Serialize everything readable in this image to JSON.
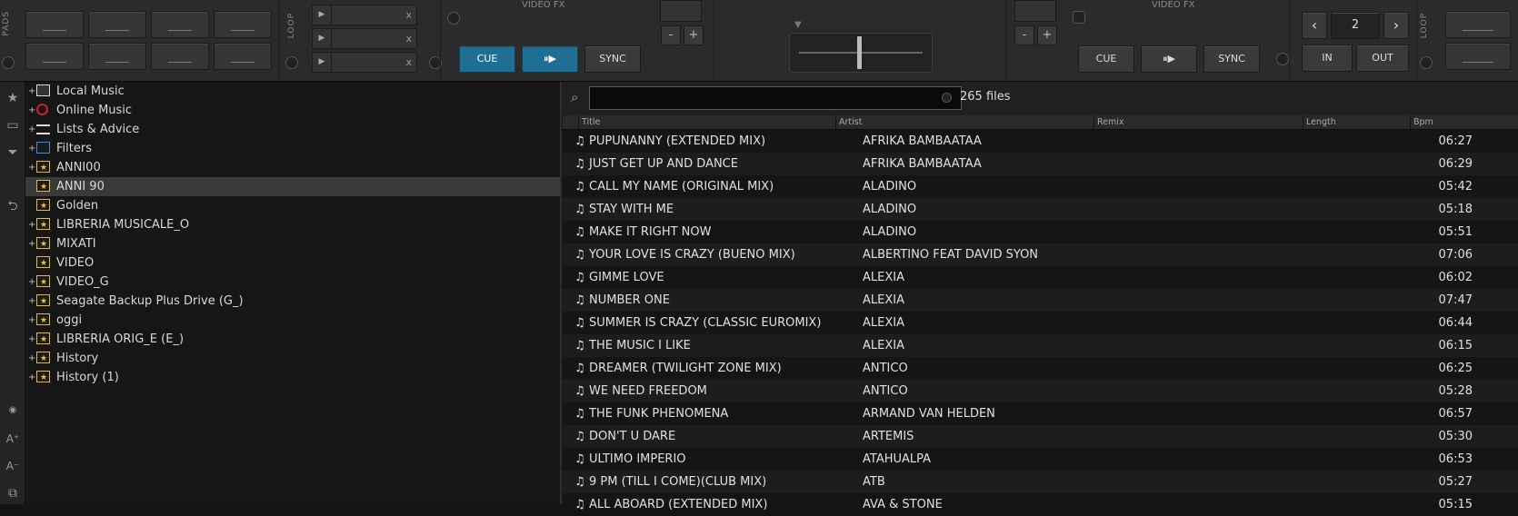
{
  "deck": {
    "pads_label": "PADS",
    "loop_label": "LOOP",
    "loop_close_label": "x",
    "video_fx_label": "VIDEO FX",
    "left_deck": {
      "cue": "CUE",
      "play": "⏸▶",
      "sync": "SYNC"
    },
    "right_deck": {
      "cue": "CUE",
      "play": "⏸▶",
      "sync": "SYNC"
    },
    "fx_minus": "-",
    "fx_plus": "+",
    "loop_size": "2",
    "prev": "‹",
    "next": "›",
    "loop_in": "IN",
    "loop_out": "OUT",
    "colors": {
      "accent": "#1f6f95",
      "panel": "#2b2b2b"
    }
  },
  "sidebar_icons": [
    "favorites-icon",
    "add-folder-icon",
    "filter-icon",
    "back-icon",
    "text-size-up-icon",
    "text-size-down-icon",
    "window-icon"
  ],
  "tree": {
    "items": [
      {
        "label": "Local Music",
        "icon": "computer-icon",
        "expand": "+"
      },
      {
        "label": "Online Music",
        "icon": "globe-icon",
        "expand": "+"
      },
      {
        "label": "Lists & Advice",
        "icon": "list-icon",
        "expand": "+"
      },
      {
        "label": "Filters",
        "icon": "filter-folder-icon",
        "expand": "+"
      },
      {
        "label": "ANNI00",
        "icon": "star-folder-icon",
        "expand": "+"
      },
      {
        "label": "ANNI 90",
        "icon": "star-folder-icon",
        "expand": "",
        "selected": true
      },
      {
        "label": "Golden",
        "icon": "star-folder-icon",
        "expand": ""
      },
      {
        "label": "LIBRERIA MUSICALE_O",
        "icon": "star-folder-icon",
        "expand": "+"
      },
      {
        "label": "MIXATI",
        "icon": "star-folder-icon",
        "expand": "+"
      },
      {
        "label": "VIDEO",
        "icon": "star-folder-icon",
        "expand": ""
      },
      {
        "label": "VIDEO_G",
        "icon": "star-folder-icon",
        "expand": "+"
      },
      {
        "label": "Seagate Backup Plus Drive (G_)",
        "icon": "star-folder-icon",
        "expand": "+"
      },
      {
        "label": "oggi",
        "icon": "star-folder-icon",
        "expand": "+"
      },
      {
        "label": "LIBRERIA ORIG_E (E_)",
        "icon": "star-folder-icon",
        "expand": "+"
      },
      {
        "label": "History",
        "icon": "star-folder-icon",
        "expand": "+"
      },
      {
        "label": "History (1)",
        "icon": "star-folder-icon",
        "expand": "+"
      }
    ],
    "folders_tab": "folders"
  },
  "browser": {
    "search_value": "",
    "file_count": "265 files",
    "columns": [
      "Title",
      "Artist",
      "Remix",
      "Length",
      "Bpm"
    ],
    "rows": [
      {
        "title": "PUPUNANNY (EXTENDED MIX)",
        "artist": "AFRIKA BAMBAATAA",
        "length": "06:27"
      },
      {
        "title": "JUST GET UP AND DANCE",
        "artist": "AFRIKA BAMBAATAA",
        "length": "06:29"
      },
      {
        "title": "CALL MY NAME (ORIGINAL MIX)",
        "artist": "ALADINO",
        "length": "05:42"
      },
      {
        "title": "STAY WITH ME",
        "artist": "ALADINO",
        "length": "05:18"
      },
      {
        "title": "MAKE IT RIGHT NOW",
        "artist": "ALADINO",
        "length": "05:51"
      },
      {
        "title": "YOUR LOVE IS CRAZY (BUENO MIX)",
        "artist": "ALBERTINO FEAT DAVID SYON",
        "length": "07:06"
      },
      {
        "title": "GIMME LOVE",
        "artist": "ALEXIA",
        "length": "06:02"
      },
      {
        "title": "NUMBER ONE",
        "artist": "ALEXIA",
        "length": "07:47"
      },
      {
        "title": "SUMMER IS CRAZY (CLASSIC EUROMIX)",
        "artist": "ALEXIA",
        "length": "06:44"
      },
      {
        "title": "THE MUSIC I LIKE",
        "artist": "ALEXIA",
        "length": "06:15"
      },
      {
        "title": "DREAMER (TWILIGHT ZONE MIX)",
        "artist": "ANTICO",
        "length": "06:25"
      },
      {
        "title": "WE NEED FREEDOM",
        "artist": "ANTICO",
        "length": "05:28"
      },
      {
        "title": "THE FUNK PHENOMENA",
        "artist": "ARMAND VAN HELDEN",
        "length": "06:57"
      },
      {
        "title": "DON'T U DARE",
        "artist": "ARTEMIS",
        "length": "05:30"
      },
      {
        "title": "ULTIMO IMPERIO",
        "artist": "ATAHUALPA",
        "length": "06:53"
      },
      {
        "title": "9 PM (TILL I COME)(CLUB MIX)",
        "artist": "ATB",
        "length": "05:27"
      },
      {
        "title": "ALL ABOARD (EXTENDED MIX)",
        "artist": "AVA & STONE",
        "length": "05:15"
      }
    ],
    "note_icon": "♫"
  }
}
